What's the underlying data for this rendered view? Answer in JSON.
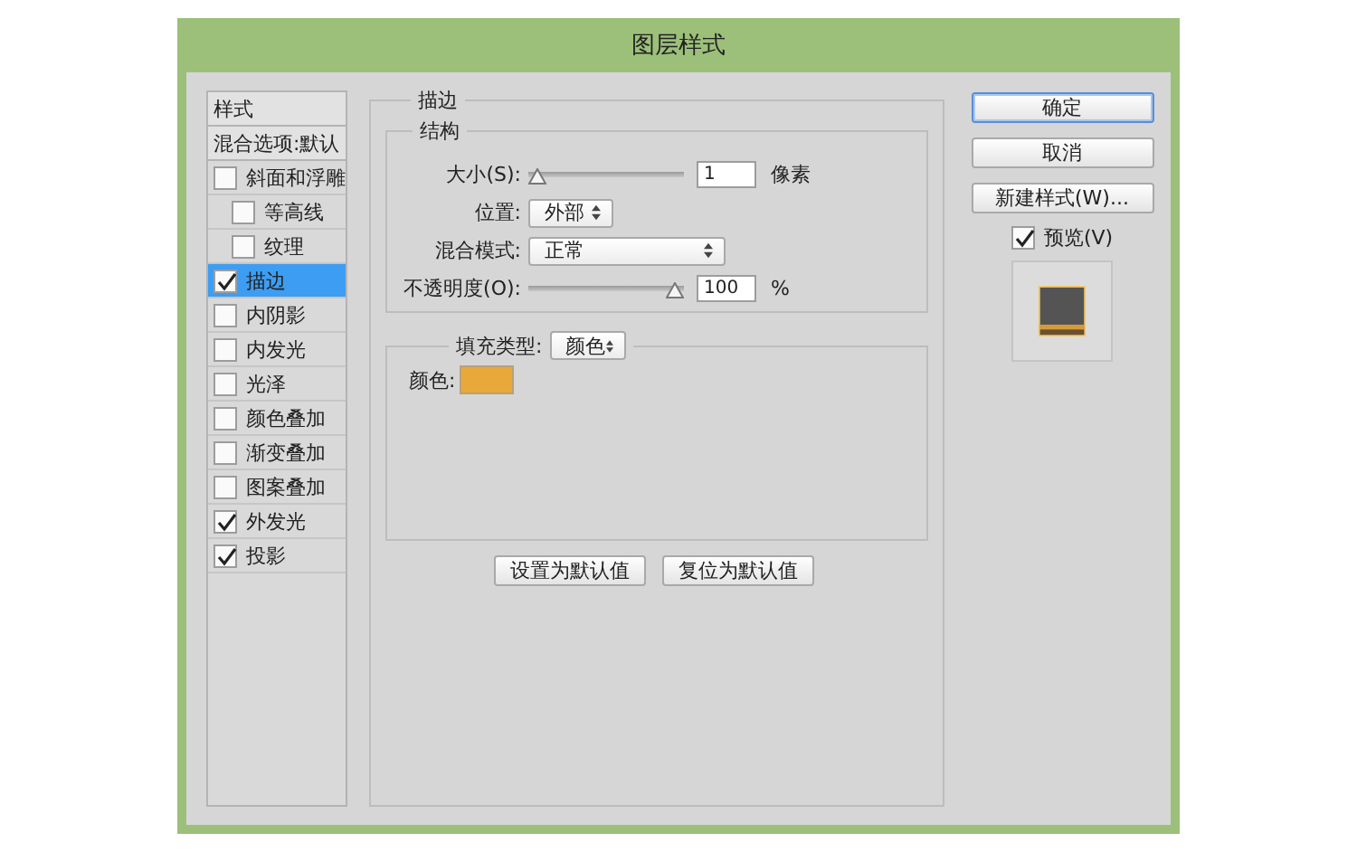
{
  "window": {
    "title": "图层样式"
  },
  "styles": {
    "items": [
      {
        "kind": "header",
        "label": "样式",
        "selected": false
      },
      {
        "kind": "header",
        "label": "混合选项:默认",
        "selected": false
      },
      {
        "kind": "checkbox",
        "label": "斜面和浮雕",
        "checked": false,
        "selected": false,
        "children": [
          {
            "kind": "checkbox",
            "label": "等高线",
            "checked": false,
            "selected": false
          },
          {
            "kind": "checkbox",
            "label": "纹理",
            "checked": false,
            "selected": false
          }
        ]
      },
      {
        "kind": "checkbox",
        "label": "描边",
        "checked": true,
        "selected": true
      },
      {
        "kind": "checkbox",
        "label": "内阴影",
        "checked": false,
        "selected": false
      },
      {
        "kind": "checkbox",
        "label": "内发光",
        "checked": false,
        "selected": false
      },
      {
        "kind": "checkbox",
        "label": "光泽",
        "checked": false,
        "selected": false
      },
      {
        "kind": "checkbox",
        "label": "颜色叠加",
        "checked": false,
        "selected": false
      },
      {
        "kind": "checkbox",
        "label": "渐变叠加",
        "checked": false,
        "selected": false
      },
      {
        "kind": "checkbox",
        "label": "图案叠加",
        "checked": false,
        "selected": false
      },
      {
        "kind": "checkbox",
        "label": "外发光",
        "checked": true,
        "selected": false
      },
      {
        "kind": "checkbox",
        "label": "投影",
        "checked": true,
        "selected": false
      }
    ]
  },
  "stroke": {
    "title": "描边",
    "structure": {
      "title": "结构",
      "size": {
        "label": "大小(S):",
        "level": 0,
        "value": "1",
        "unit": "像素"
      },
      "position": {
        "label": "位置:",
        "value": "外部"
      },
      "blend_mode": {
        "label": "混合模式:",
        "value": "正常"
      },
      "opacity": {
        "label": "不透明度(O):",
        "level": 1,
        "value": "100",
        "unit": "%"
      }
    },
    "fill": {
      "label": "填充类型:",
      "value": "颜色",
      "color_label": "颜色:",
      "color": "#e9a93a"
    },
    "buttons": [
      "设置为默认值",
      "复位为默认值"
    ]
  },
  "actions": {
    "buttons": [
      {
        "label": "确定",
        "default": true
      },
      {
        "label": "取消",
        "default": false
      },
      {
        "label": "新建样式(W)...",
        "default": false
      }
    ],
    "preview": {
      "label": "预览(V)",
      "checked": true
    }
  }
}
